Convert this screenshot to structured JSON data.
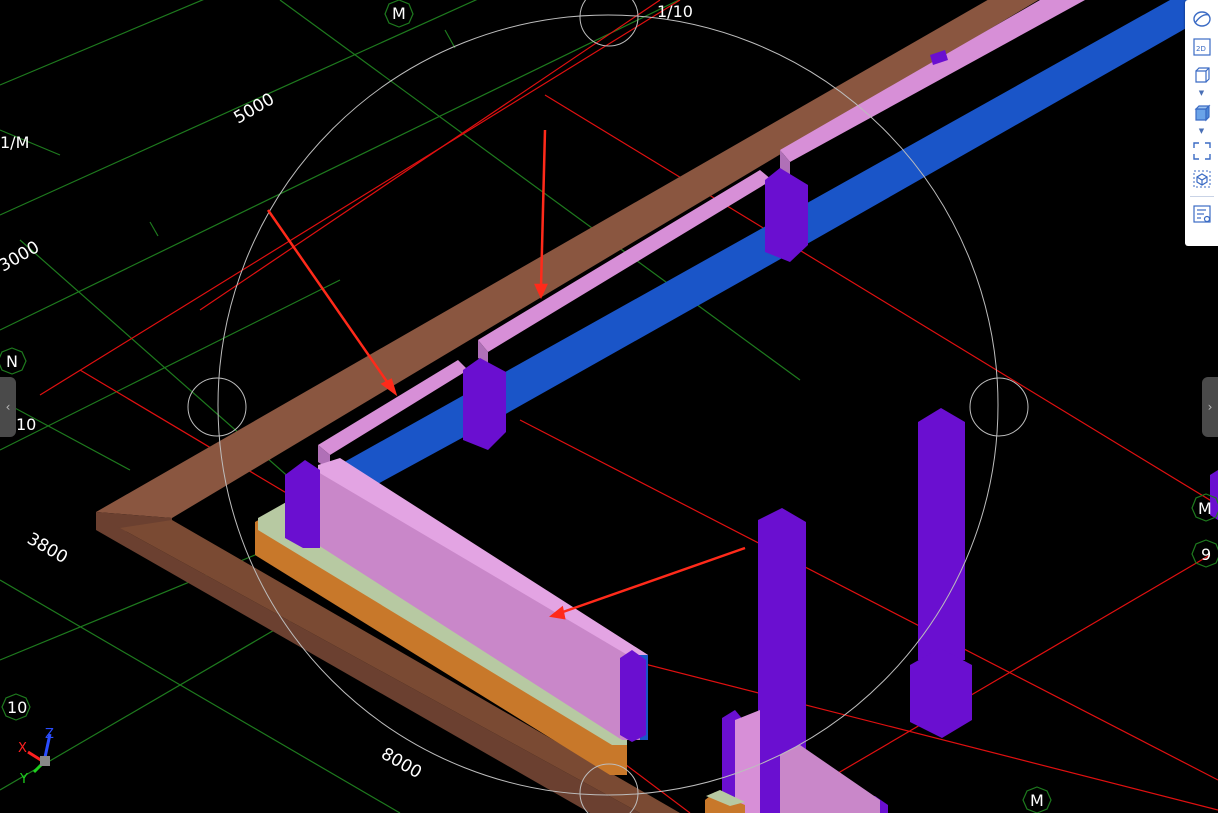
{
  "viewport": {
    "background": "#000000",
    "dimension_labels": [
      "5000",
      "3000",
      "3800",
      "8000"
    ],
    "grid_labels": {
      "m_top": "M",
      "ratio_top": "1/10",
      "ratio_left": "1/M",
      "n_left": "N",
      "ten_left": "10",
      "m_right": "M",
      "nine_right": "9",
      "ten_bottom": "10",
      "m_bottom": "M"
    },
    "axis_triad": {
      "x": "X",
      "y": "Y",
      "z": "Z"
    },
    "colors": {
      "grid_green": "#1e7a1e",
      "axis_red": "#e01010",
      "beam_brown": "#7a4a33",
      "beam_blue": "#1a55c8",
      "slab_pink": "#c987c9",
      "column_purple": "#6a0fd0",
      "pad_orange": "#c8782a",
      "pad_sage": "#b7c9a2",
      "arrow_red": "#ff2a1a",
      "orbit_circle": "#bdbdbd"
    }
  },
  "toolbar": {
    "icons": [
      "orbit-icon",
      "2d-view-icon",
      "3d-box-icon",
      "3d-filled-box-icon",
      "fit-view-icon",
      "section-box-icon",
      "property-list-icon"
    ],
    "twod_text": "2D"
  },
  "nav": {
    "left_arrow": "‹",
    "right_arrow": "›"
  }
}
